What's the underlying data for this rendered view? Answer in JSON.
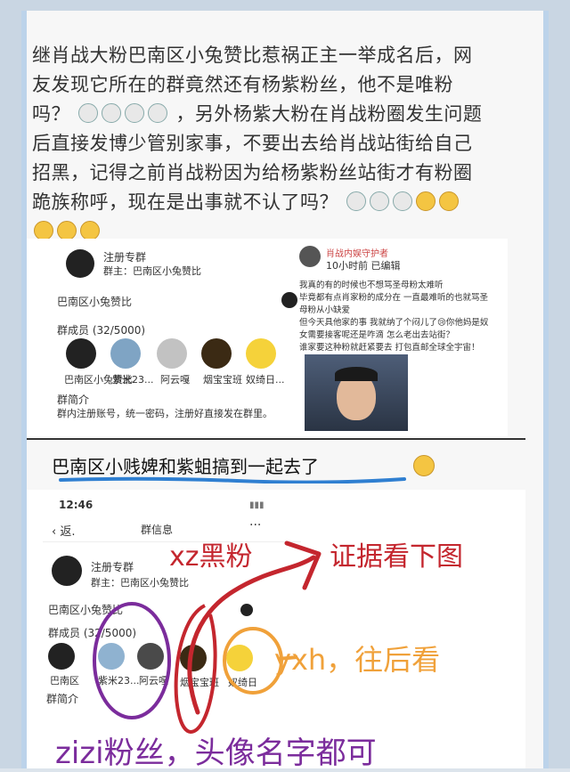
{
  "intro": {
    "line1": "继肖战大粉巴南区小兔赞比惹祸正主一举成名后，网",
    "line2": "友发现它所在的群竟然还有杨紫粉丝，他不是唯粉",
    "line3a": "吗？",
    "line3b": "，另外杨紫大粉在肖战粉圈发生问题",
    "line4": "后直接发博少管别家事，不要出去给肖战站街给自己",
    "line5": "招黑，记得之前肖战粉因为给杨紫粉丝站街才有粉圈",
    "line6": "跪族称呼，现在是出事就不认了吗？"
  },
  "shot1": {
    "group_name": "注册专群",
    "group_sub": "群主：巴南区小兔赞比",
    "chat_name": "巴南区小兔赞比",
    "members_label": "群成员 (32/5000)",
    "members": [
      "巴南区小兔赞比",
      "紫米23...",
      "阿云嘎",
      "烟宝宝班",
      "奴绮日..."
    ],
    "intro_label": "群简介",
    "intro_text": "群内注册账号，统一密码，注册好直接发在群里。",
    "post_user": "肖战内娱守护者",
    "post_time": "10小时前  已编辑",
    "post_lines": [
      "我真的有的时候也不想骂圣母粉太难听",
      "毕竟都有点肖家粉的成分在 一直最难听的也就骂圣",
      "母粉从小缺爱",
      "但今天具他家的事 我就纳了个闷儿了😢你他妈是奴",
      "女需要接客呢还是咋滴 怎么老出去站街？",
      "谁家要这种粉就赶紧要去 打包直邮全球全宇宙！"
    ]
  },
  "caption": "巴南区小贱婢和紫蛆搞到一起去了",
  "shot2": {
    "time": "12:46",
    "back": "返.",
    "title": "群信息",
    "group_name": "注册专群",
    "group_sub": "群主：巴南区小兔赞比",
    "chat_name": "巴南区小兔赞比",
    "members_label": "群成员 (32/5000)",
    "members": [
      "巴南区",
      "紫米23...",
      "阿云嘎",
      "烟宝宝班",
      "奴绮日"
    ],
    "intro_label": "群简介"
  },
  "annotations": {
    "xz": "xz黑粉",
    "evidence": "证据看下图",
    "yxh": "yxh，往后看",
    "zizi": "zizi粉丝，头像名字都可"
  },
  "colors": {
    "red": "#c4262e",
    "orange": "#f0a13a",
    "purple": "#7b2c9c",
    "blue": "#2f7fd1"
  }
}
